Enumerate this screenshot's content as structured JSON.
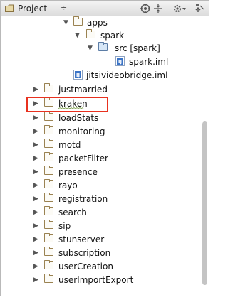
{
  "header": {
    "title": "Project",
    "dropdown_glyph": "÷",
    "icons": [
      "target-icon",
      "collapse-icon",
      "gear-icon",
      "hide-icon"
    ]
  },
  "tree": {
    "rows": [
      {
        "label": "apps",
        "state": "expanded"
      },
      {
        "label": "spark",
        "state": "expanded"
      },
      {
        "label": "src [spark]",
        "state": "expanded"
      },
      {
        "label": "spark.iml",
        "state": "file"
      },
      {
        "label": "jitsivideobridge.iml",
        "state": "file"
      },
      {
        "label": "justmarried",
        "state": "collapsed"
      },
      {
        "label": "kraken",
        "state": "collapsed"
      },
      {
        "label": "loadStats",
        "state": "collapsed"
      },
      {
        "label": "monitoring",
        "state": "collapsed"
      },
      {
        "label": "motd",
        "state": "collapsed"
      },
      {
        "label": "packetFilter",
        "state": "collapsed"
      },
      {
        "label": "presence",
        "state": "collapsed"
      },
      {
        "label": "rayo",
        "state": "collapsed"
      },
      {
        "label": "registration",
        "state": "collapsed"
      },
      {
        "label": "search",
        "state": "collapsed"
      },
      {
        "label": "sip",
        "state": "collapsed"
      },
      {
        "label": "stunserver",
        "state": "collapsed"
      },
      {
        "label": "subscription",
        "state": "collapsed"
      },
      {
        "label": "userCreation",
        "state": "collapsed"
      },
      {
        "label": "userImportExport",
        "state": "collapsed"
      }
    ]
  },
  "colors": {
    "highlight": "#e8311f",
    "folder": "#9a8251",
    "source_folder": "#5c7da6"
  }
}
